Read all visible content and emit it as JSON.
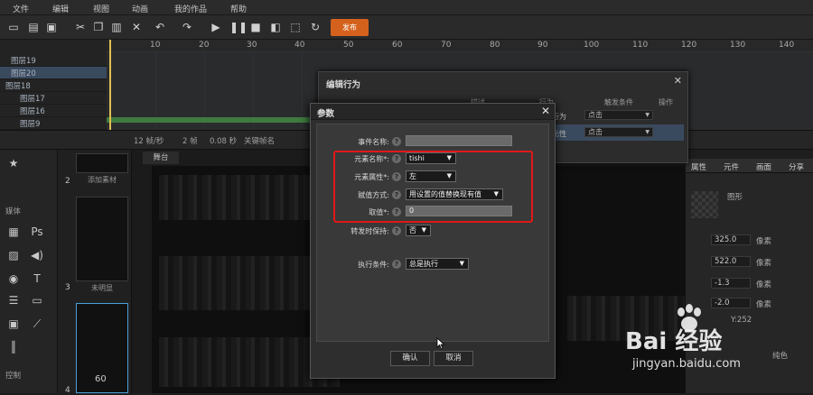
{
  "menu": [
    "文件",
    "编辑",
    "视图",
    "动画",
    "我的作品",
    "帮助"
  ],
  "toolbar": {
    "publish_label": "发布"
  },
  "ruler": [
    "10",
    "20",
    "30",
    "40",
    "50",
    "60",
    "70",
    "80",
    "90",
    "100",
    "110",
    "120",
    "130",
    "140"
  ],
  "layers": [
    "图层19",
    "图层20",
    "图层18",
    "图层17",
    "图层16",
    "图层9"
  ],
  "status": {
    "fps": "12 帧/秒",
    "frame": "2 帧",
    "time": "0.08 秒",
    "keyframe_label": "关键帧名"
  },
  "leftbar": {
    "media_label": "媒体",
    "widgets_label": "控制"
  },
  "thumbs": {
    "n2": "2",
    "n3": "3",
    "n4": "4",
    "cap2": "添加素材",
    "cap3": "未明显",
    "digit": "60"
  },
  "stage": {
    "tab": "舞台"
  },
  "rightpanel": {
    "tabs": [
      "属性",
      "元件",
      "画面",
      "分享"
    ],
    "img_label": "图形",
    "w_val": "325.0",
    "h_val": "522.0",
    "x_val": "-1.3",
    "y_val": "-2.0",
    "unit": "像素",
    "y_readout": "Y:252",
    "fill_label": "纯色"
  },
  "behavior_dialog": {
    "title": "编辑行为",
    "cols": [
      "描述",
      "行为",
      "触发条件",
      "操作"
    ],
    "row1_action": "行为",
    "row1_trigger": "点击",
    "row2_action": "元性",
    "row2_trigger": "点击"
  },
  "param_dialog": {
    "title": "参数",
    "event_name_label": "事件名称:",
    "element_name_label": "元素名称*:",
    "element_name_value": "tishi",
    "element_attr_label": "元素属性*:",
    "element_attr_value": "左",
    "assign_method_label": "赋值方式:",
    "assign_method_value": "用设置的值替换现有值",
    "value_label": "取值*:",
    "value_value": "0",
    "keep_label": "转发时保持:",
    "keep_value": "否",
    "condition_label": "执行条件:",
    "condition_value": "总是执行",
    "ok_label": "确认",
    "cancel_label": "取消"
  },
  "watermark": {
    "logo": "Bai 经验",
    "url": "jingyan.baidu.com"
  },
  "colors": {
    "publish": "#d4621d",
    "highlight": "#e01818"
  }
}
